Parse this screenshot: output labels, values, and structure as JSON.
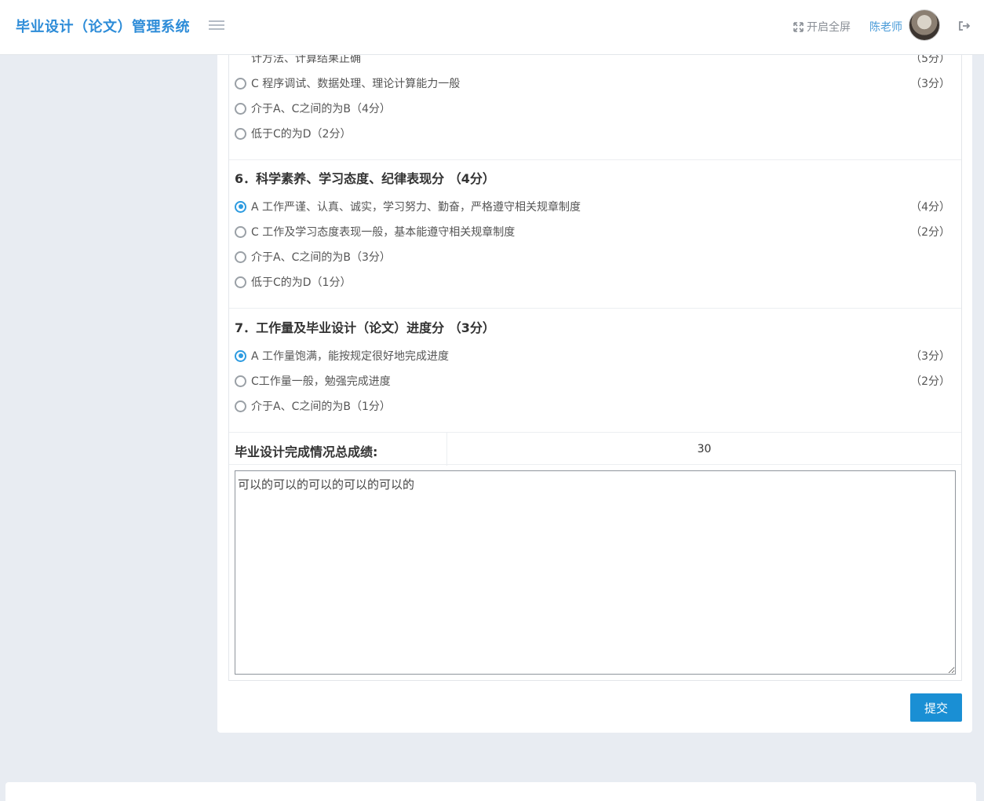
{
  "app": {
    "title": "毕业设计（论文）管理系统"
  },
  "header": {
    "fullscreen_label": "开启全屏",
    "user_name": "陈老师",
    "accent": "#2d8cd8"
  },
  "partial_top": {
    "text": "计方法、计算结果正确",
    "score": "（5分）"
  },
  "q5_options": [
    {
      "label": "C 程序调试、数据处理、理论计算能力一般",
      "score": "（3分）",
      "checked": false
    },
    {
      "label": "介于A、C之间的为B（4分）",
      "score": "",
      "checked": false
    },
    {
      "label": "低于C的为D（2分）",
      "score": "",
      "checked": false
    }
  ],
  "questions": [
    {
      "title": "6．科学素养、学习态度、纪律表现分 （4分）",
      "options": [
        {
          "label": "A 工作严谨、认真、诚实，学习努力、勤奋，严格遵守相关规章制度",
          "score": "（4分）",
          "checked": true
        },
        {
          "label": "C 工作及学习态度表现一般，基本能遵守相关规章制度",
          "score": "（2分）",
          "checked": false
        },
        {
          "label": "介于A、C之间的为B（3分）",
          "score": "",
          "checked": false
        },
        {
          "label": "低于C的为D（1分）",
          "score": "",
          "checked": false
        }
      ]
    },
    {
      "title": "7．工作量及毕业设计（论文）进度分 （3分）",
      "options": [
        {
          "label": "A 工作量饱满，能按规定很好地完成进度",
          "score": "（3分）",
          "checked": true
        },
        {
          "label": "C工作量一般，勉强完成进度",
          "score": "（2分）",
          "checked": false
        },
        {
          "label": "介于A、C之间的为B（1分）",
          "score": "",
          "checked": false
        }
      ]
    }
  ],
  "total": {
    "label": "毕业设计完成情况总成绩:",
    "value": "30"
  },
  "comment": {
    "value": "可以的可以的可以的可以的可以的"
  },
  "submit_label": "提交"
}
